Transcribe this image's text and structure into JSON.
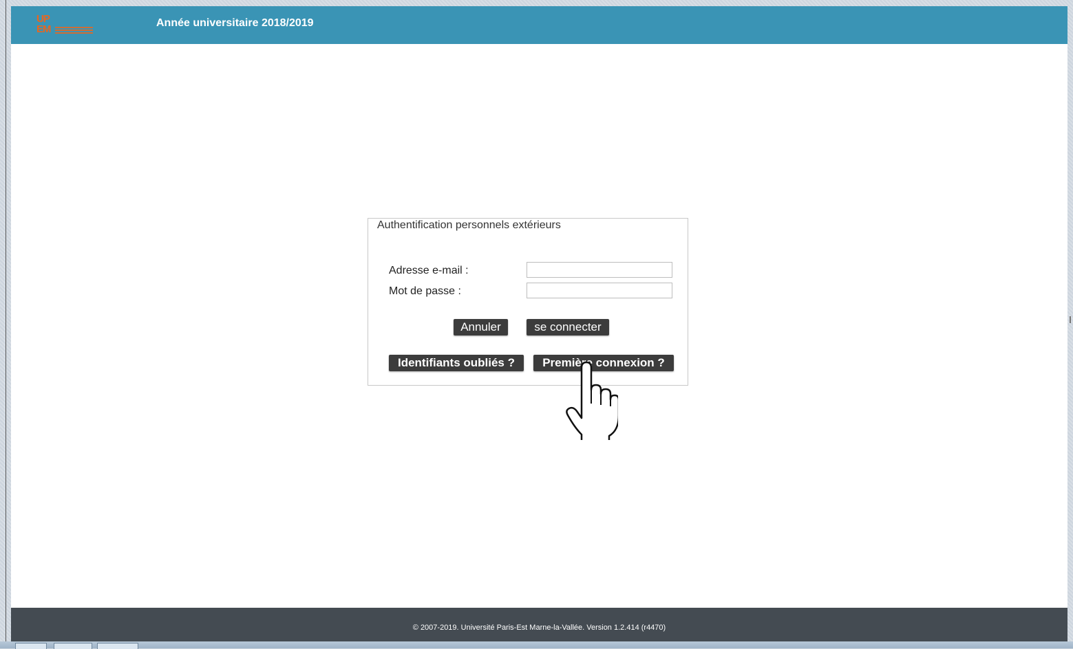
{
  "header": {
    "logo_text_line1": "UP",
    "logo_text_line2": "EM",
    "title": "Année universitaire 2018/2019"
  },
  "auth": {
    "legend": "Authentification personnels extérieurs",
    "email_label": "Adresse e-mail :",
    "email_value": "",
    "password_label": "Mot de passe :",
    "password_value": "",
    "cancel_label": "Annuler",
    "login_label": "se connecter",
    "forgot_label": "Identifiants oubliés ?",
    "first_login_label": "Première connexion ?"
  },
  "footer": {
    "text": "© 2007-2019. Université Paris-Est Marne-la-Vallée. Version 1.2.414 (r4470)"
  },
  "colors": {
    "header": "#3a94b5",
    "footer": "#444b52",
    "button": "#3c3c3c",
    "logo": "#e8661e"
  },
  "icons": {
    "cursor": "hand-pointer-icon"
  }
}
